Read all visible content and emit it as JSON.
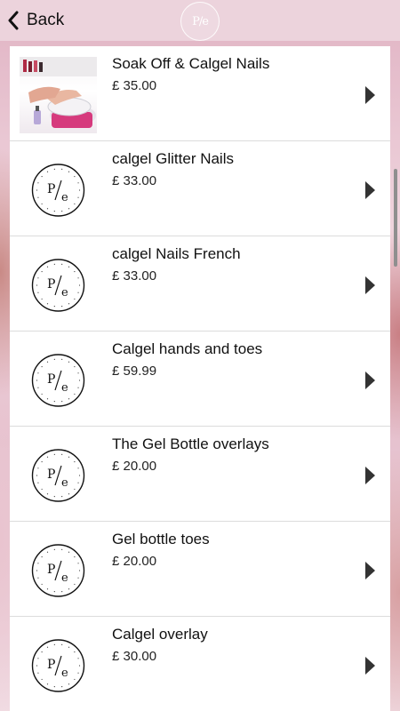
{
  "header": {
    "back_label": "Back",
    "logo_text": "P/e"
  },
  "services": [
    {
      "name": "Soak Off & Calgel Nails",
      "price": "£ 35.00",
      "image": "photo"
    },
    {
      "name": "calgel Glitter Nails",
      "price": "£ 33.00",
      "image": "logo"
    },
    {
      "name": "calgel Nails French",
      "price": "£ 33.00",
      "image": "logo"
    },
    {
      "name": "Calgel hands and toes",
      "price": "£ 59.99",
      "image": "logo"
    },
    {
      "name": "The Gel Bottle overlays",
      "price": "£ 20.00",
      "image": "logo"
    },
    {
      "name": "Gel bottle toes",
      "price": "£ 20.00",
      "image": "logo"
    },
    {
      "name": "Calgel overlay",
      "price": "£ 30.00",
      "image": "logo"
    }
  ],
  "colors": {
    "topbar": "#ecd3dc",
    "arrow": "#333333"
  }
}
